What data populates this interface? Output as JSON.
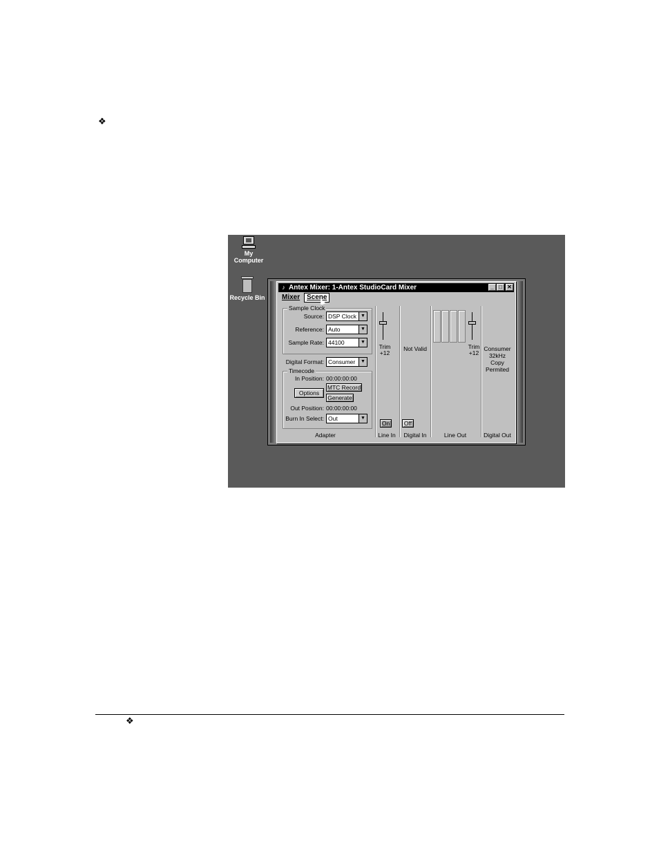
{
  "desktop": {
    "icons": [
      {
        "label_line1": "My",
        "label_line2": "Computer"
      },
      {
        "label_line1": "Recycle Bin",
        "label_line2": ""
      }
    ]
  },
  "window": {
    "title": "Antex Mixer: 1-Antex StudioCard Mixer",
    "controls": {
      "minimize": "_",
      "maximize": "□",
      "close": "✕"
    }
  },
  "menu": [
    {
      "label": "Mixer"
    },
    {
      "label": "Scene"
    }
  ],
  "adapter": {
    "sample_clock": {
      "title": "Sample Clock",
      "source_label": "Source:",
      "source_value": "DSP Clock",
      "reference_label": "Reference:",
      "reference_value": "Auto",
      "sample_rate_label": "Sample Rate:",
      "sample_rate_value": "44100"
    },
    "digital_format_label": "Digital Format:",
    "digital_format_value": "Consumer",
    "timecode": {
      "title": "Timecode",
      "in_position_label": "In Position:",
      "in_position_value": "00:00:00:00",
      "options_button": "Options",
      "mtc_record_button": "MTC Record",
      "generate_button": "Generate",
      "out_position_label": "Out Position:",
      "out_position_value": "00:00:00:00",
      "burn_in_label": "Burn In Select:",
      "burn_in_value": "Out"
    },
    "section_label": "Adapter"
  },
  "line_in": {
    "trim_label": "Trim",
    "trim_value": "+12",
    "on_button": "On",
    "section_label": "Line In"
  },
  "digital_in": {
    "status": "Not Valid",
    "off_button": "Off",
    "section_label": "Digital In"
  },
  "line_out": {
    "trim_label": "Trim",
    "trim_value": "+12",
    "section_label": "Line Out"
  },
  "digital_out": {
    "line1": "Consumer",
    "line2": "32kHz",
    "line3": "Copy",
    "line4": "Permited",
    "section_label": "Digital Out"
  },
  "page": {
    "bullet": "❖"
  }
}
